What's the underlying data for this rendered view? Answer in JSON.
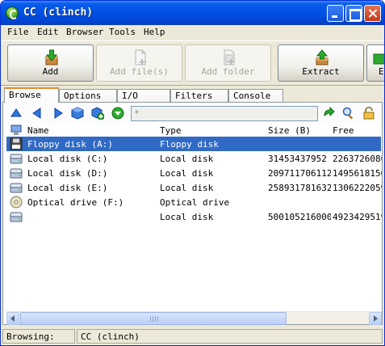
{
  "window": {
    "title": "CC (clinch)",
    "icon": "cc-app-icon"
  },
  "menu": [
    "File",
    "Edit",
    "Browser",
    "Tools",
    "Help"
  ],
  "toolbar": {
    "add_label": "Add",
    "add_files_label": "Add file(s)",
    "add_folder_label": "Add folder",
    "extract_label": "Extract",
    "overflow_label": "E"
  },
  "tabs": [
    "Browse",
    "Options",
    "I/O",
    "Filters",
    "Console"
  ],
  "nav": {
    "path_value": "*"
  },
  "columns": {
    "name": "Name",
    "type": "Type",
    "size": "Size (B)",
    "free": "Free"
  },
  "rows": [
    {
      "name": "Floppy disk (A:)",
      "type": "Floppy disk",
      "size": "",
      "free": "",
      "icon": "floppy-icon",
      "selected": true
    },
    {
      "name": "Local disk (C:)",
      "type": "Local disk",
      "size": "31453437952",
      "free": "2263726080",
      "icon": "hard-disk-icon"
    },
    {
      "name": "Local disk (D:)",
      "type": "Local disk",
      "size": "209711706112",
      "free": "1495618150",
      "icon": "hard-disk-icon"
    },
    {
      "name": "Local disk (E:)",
      "type": "Local disk",
      "size": "258931781632",
      "free": "1306222059",
      "icon": "hard-disk-icon"
    },
    {
      "name": "Optical drive (F:)",
      "type": "Optical drive",
      "size": "",
      "free": "",
      "icon": "optical-drive-icon"
    },
    {
      "name": "",
      "type": "Local disk",
      "size": "500105216000",
      "free": "4923429519",
      "icon": "hard-disk-icon"
    }
  ],
  "status": {
    "label": "Browsing:",
    "value": "CC (clinch)"
  },
  "colors": {
    "selection": "#316AC5",
    "title_bar": "#0052E5"
  }
}
